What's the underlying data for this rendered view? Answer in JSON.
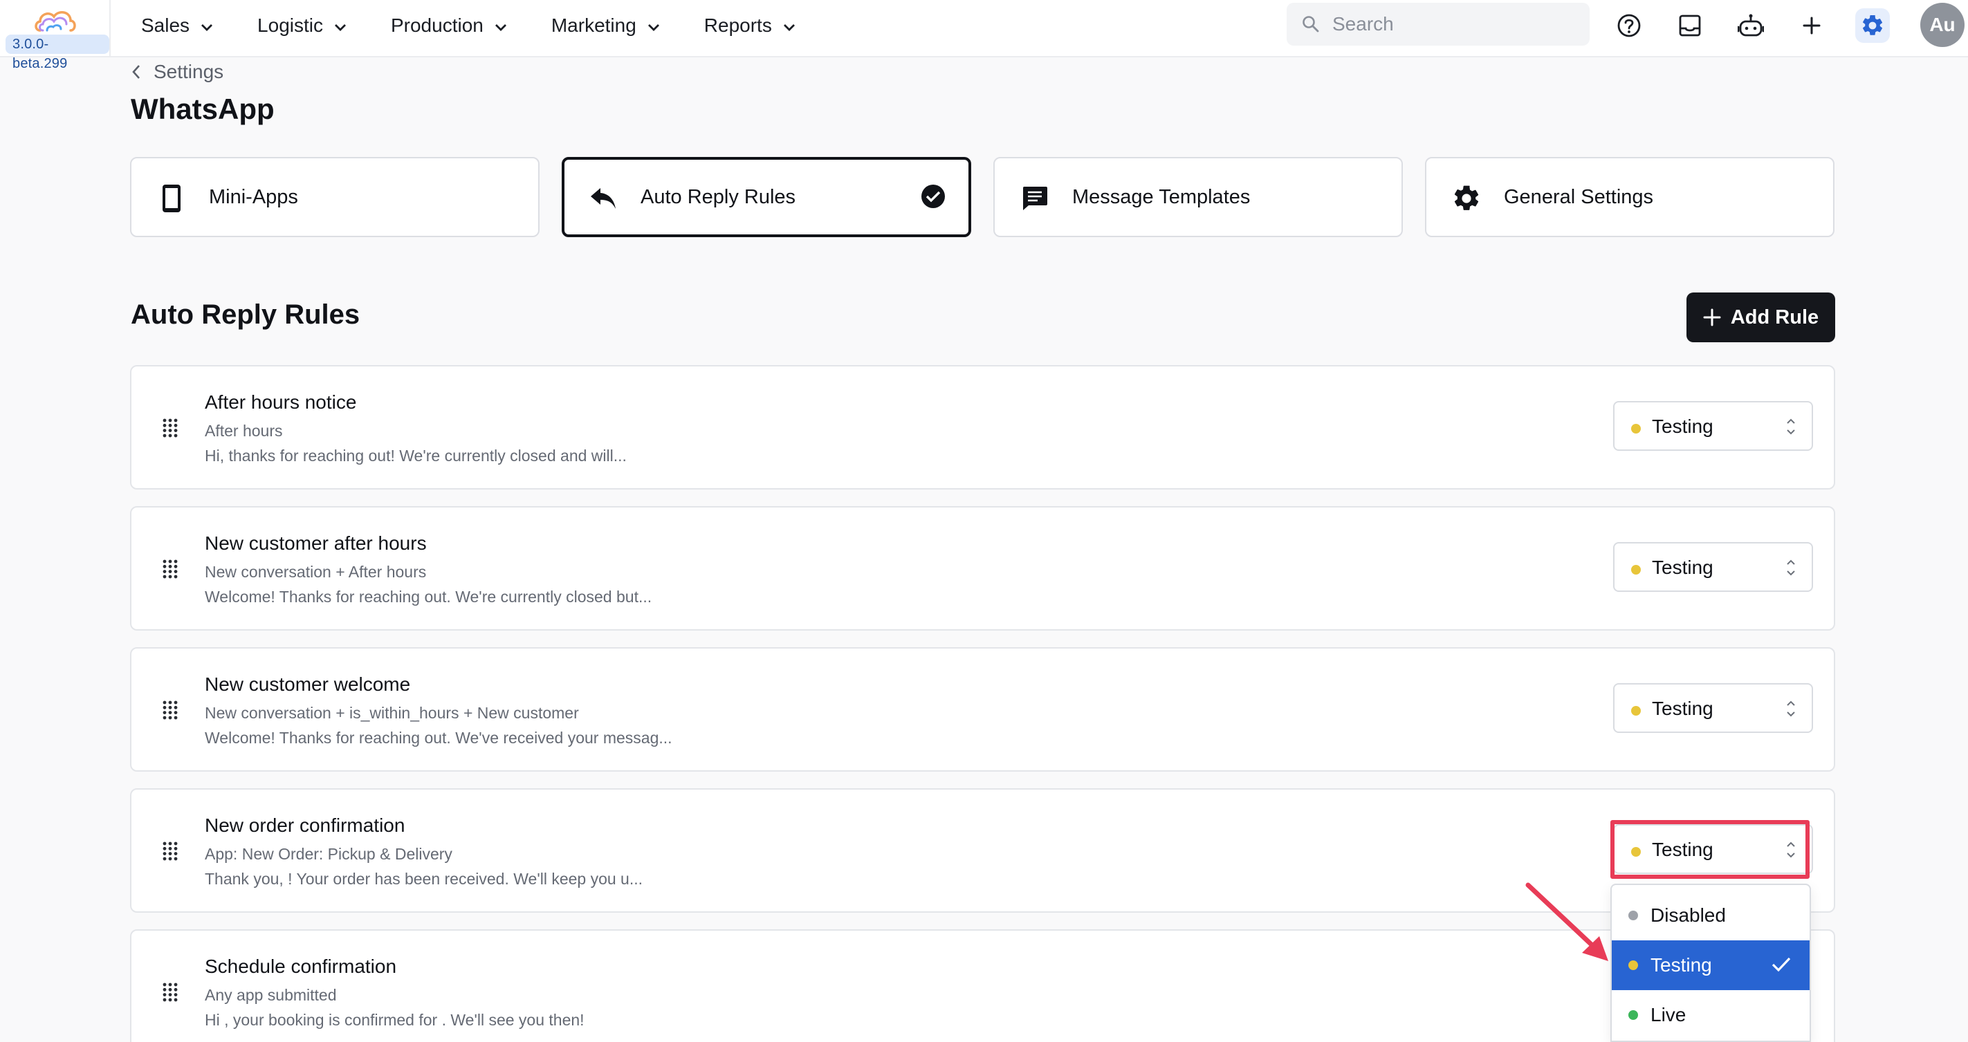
{
  "app": {
    "version": "3.0.0-beta.299",
    "avatar_initials": "Au"
  },
  "nav": {
    "items": [
      {
        "label": "Sales",
        "icon": "chevron-down-icon"
      },
      {
        "label": "Logistic",
        "icon": "chevron-down-icon"
      },
      {
        "label": "Production",
        "icon": "chevron-down-icon"
      },
      {
        "label": "Marketing",
        "icon": "chevron-down-icon"
      },
      {
        "label": "Reports",
        "icon": "chevron-down-icon"
      }
    ]
  },
  "search": {
    "placeholder": "Search",
    "value": ""
  },
  "toolbar_icons": [
    "help-icon",
    "inbox-icon",
    "bot-icon",
    "plus-icon",
    "gear-icon"
  ],
  "breadcrumb": {
    "parent": "Settings"
  },
  "page": {
    "title": "WhatsApp"
  },
  "tabs": [
    {
      "label": "Mini-Apps",
      "icon": "phone-icon",
      "active": false
    },
    {
      "label": "Auto Reply Rules",
      "icon": "reply-icon",
      "active": true
    },
    {
      "label": "Message Templates",
      "icon": "chat-icon",
      "active": false
    },
    {
      "label": "General Settings",
      "icon": "gear-icon",
      "active": false
    }
  ],
  "section": {
    "title": "Auto Reply Rules",
    "add_button": "Add Rule"
  },
  "rules": [
    {
      "title": "After hours notice",
      "conditions": "After hours",
      "preview": "Hi, thanks for reaching out! We're currently closed and will...",
      "status": "Testing"
    },
    {
      "title": "New customer after hours",
      "conditions": "New conversation + After hours",
      "preview": "Welcome! Thanks for reaching out. We're currently closed but...",
      "status": "Testing"
    },
    {
      "title": "New customer welcome",
      "conditions": "New conversation + is_within_hours + New customer",
      "preview": "Welcome! Thanks for reaching out. We've received your messag...",
      "status": "Testing"
    },
    {
      "title": "New order confirmation",
      "conditions": "App: New Order: Pickup & Delivery",
      "preview": "Thank you, ! Your order has been received. We'll keep you u...",
      "status": "Testing"
    },
    {
      "title": "Schedule confirmation",
      "conditions": "Any app submitted",
      "preview": "Hi , your booking is confirmed for . We'll see you then!",
      "status": "Testing"
    }
  ],
  "status_dropdown": {
    "options": [
      {
        "label": "Disabled",
        "color": "#9ea2a9",
        "selected": false
      },
      {
        "label": "Testing",
        "color": "#e8c53a",
        "selected": true
      },
      {
        "label": "Live",
        "color": "#3cb65a",
        "selected": false
      }
    ]
  },
  "colors": {
    "accent": "#2864d2",
    "primary_button": "#15171c",
    "testing": "#e8c53a",
    "live": "#3cb65a",
    "disabled": "#9ea2a9",
    "annotation": "#e83c57"
  }
}
